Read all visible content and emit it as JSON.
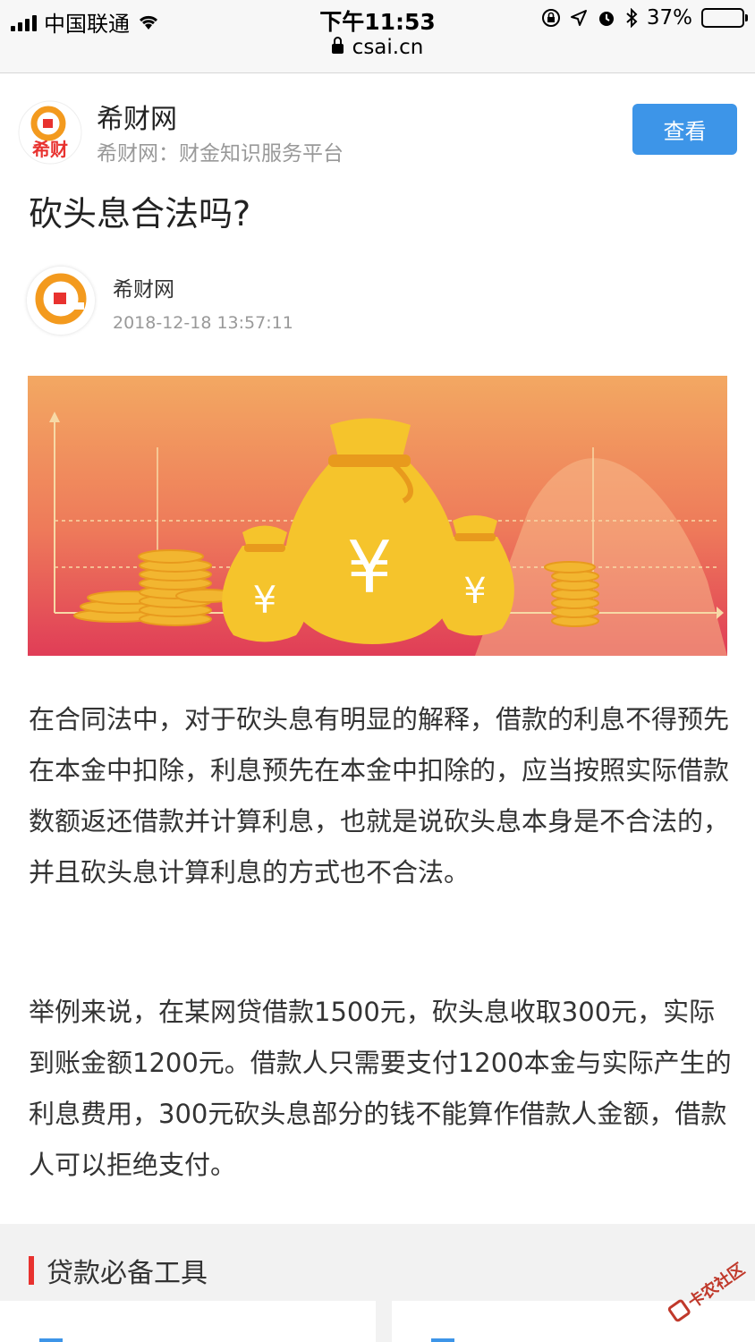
{
  "status_bar": {
    "carrier": "中国联通",
    "time": "下午11:53",
    "battery": "37%",
    "battery_level": 0.37,
    "url": "csai.cn"
  },
  "site": {
    "name": "希财网",
    "subtitle": "希财网：财金知识服务平台",
    "view_button": "查看",
    "logo_text": "希财"
  },
  "article": {
    "title": "砍头息合法吗?",
    "author": "希财网",
    "date": "2018-12-18 13:57:11",
    "paragraphs": [
      "在合同法中，对于砍头息有明显的解释，借款的利息不得预先在本金中扣除，利息预先在本金中扣除的，应当按照实际借款数额返还借款并计算利息，也就是说砍头息本身是不合法的，并且砍头息计算利息的方式也不合法。",
      "举例来说，在某网贷借款1500元，砍头息收取300元，实际到账金额1200元。借款人只需要支付1200本金与实际产生的利息费用，300元砍头息部分的钱不能算作借款人金额，借款人可以拒绝支付。"
    ]
  },
  "banner": {
    "yen_symbol": "¥",
    "colors": {
      "top": "#f3a862",
      "bottom": "#e03d57",
      "gold": "#f5c42c",
      "coin": "#f2b630"
    }
  },
  "tools": {
    "title": "贷款必备工具"
  },
  "watermark": {
    "text": "卡农社区"
  },
  "colors": {
    "accent_blue": "#3d95e8",
    "accent_red": "#e8322f"
  }
}
